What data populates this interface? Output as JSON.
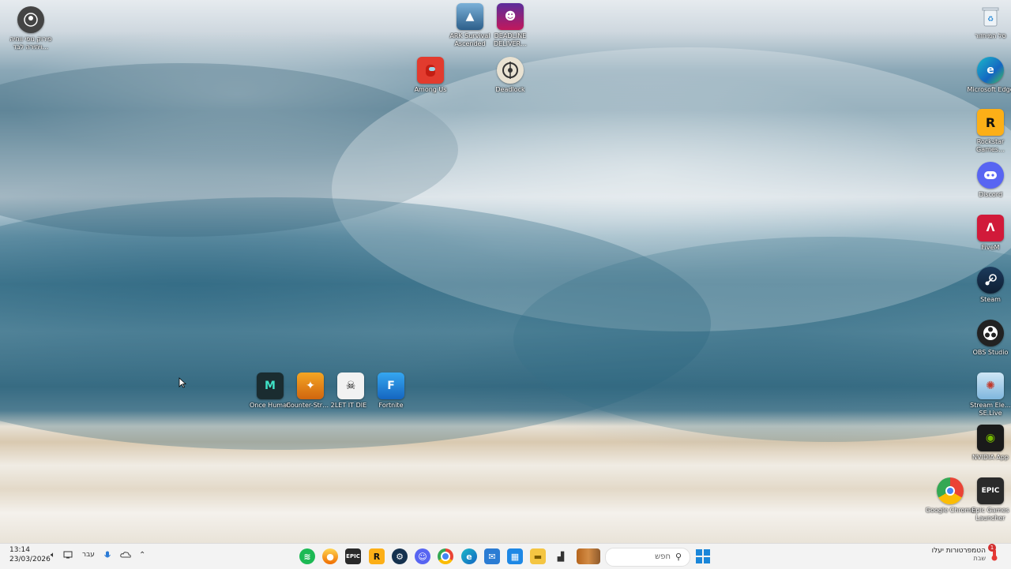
{
  "desktop": {
    "icons": {
      "top_left": {
        "label": "פירוק נופי ווחיה ויתירה לבד…",
        "icon": "person-circle-icon"
      },
      "ark": {
        "label": "ARK Survival Ascended",
        "icon": "ark-icon"
      },
      "deadline": {
        "label": "DEADLINE DELIVER…",
        "icon": "deadline-icon"
      },
      "among_us": {
        "label": "Among Us",
        "icon": "among-us-icon"
      },
      "deadlock": {
        "label": "Deadlock",
        "icon": "deadlock-icon"
      },
      "once_human": {
        "label": "Once Human",
        "icon": "once-human-icon"
      },
      "counter_strike": {
        "label": "Counter-Str… 2",
        "icon": "counter-strike-icon"
      },
      "let_it_die": {
        "label": "LET IT DIE",
        "icon": "let-it-die-icon"
      },
      "fortnite": {
        "label": "Fortnite",
        "icon": "fortnite-icon"
      },
      "recycle_bin": {
        "label": "סל המיחזור",
        "icon": "recycle-bin-icon"
      },
      "edge": {
        "label": "Microsoft Edge",
        "icon": "edge-icon"
      },
      "rockstar": {
        "label": "Rockstar Games…",
        "icon": "rockstar-icon"
      },
      "discord": {
        "label": "Discord",
        "icon": "discord-icon"
      },
      "fivem": {
        "label": "FiveM",
        "icon": "fivem-icon"
      },
      "steam": {
        "label": "Steam",
        "icon": "steam-icon"
      },
      "obs": {
        "label": "OBS Studio",
        "icon": "obs-icon"
      },
      "streamlabs": {
        "label": "Stream Ele… SE.Live",
        "icon": "streamlabs-icon"
      },
      "nvidia": {
        "label": "NVIDIA App",
        "icon": "nvidia-icon"
      },
      "chrome": {
        "label": "Google Chrome",
        "icon": "chrome-icon"
      },
      "epic": {
        "label": "Epic Games Launcher",
        "icon": "epic-icon"
      }
    }
  },
  "taskbar": {
    "clock_time": "13:14",
    "clock_date": "23/03/2026",
    "language": "עבר",
    "search_placeholder": "חפש",
    "notification_text": "הטמפרטורות יעלו",
    "notification_sub": "שבת",
    "notification_badge": "1",
    "epic_glyph": "EPIC",
    "rockstar_glyph": "R"
  }
}
